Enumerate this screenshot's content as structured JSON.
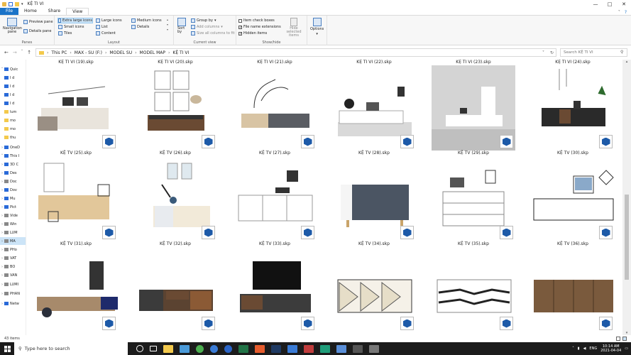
{
  "window": {
    "title": "KỆ TI VI",
    "controls": [
      "—",
      "□",
      "✕"
    ]
  },
  "tabs": [
    {
      "label": "File",
      "style": "file"
    },
    {
      "label": "Home",
      "style": ""
    },
    {
      "label": "Share",
      "style": ""
    },
    {
      "label": "View",
      "style": "view"
    }
  ],
  "ribbon": {
    "panes": {
      "navigation_pane": "Navigation pane",
      "preview_pane": "Preview pane",
      "details_pane": "Details pane",
      "label": "Panes"
    },
    "layout": {
      "items": [
        "Extra large icons",
        "Large icons",
        "Medium icons",
        "Small icons",
        "List",
        "Details",
        "Tiles",
        "Content"
      ],
      "label": "Layout"
    },
    "current_view": {
      "sort_by": "Sort by",
      "group_by": "Group by",
      "add_columns": "Add columns",
      "size_columns": "Size all columns to fit",
      "label": "Current view"
    },
    "show_hide": {
      "item_check_boxes": "Item check boxes",
      "file_name_extensions": "File name extensions",
      "hidden_items": "Hidden items",
      "hide_selected": "Hide selected items",
      "label": "Show/hide"
    },
    "options": "Options"
  },
  "address": {
    "crumbs": [
      "This PC",
      "MAX - SU (F:)",
      "MODEL SU",
      "MODEL MAP",
      "KỆ TI VI"
    ],
    "search_placeholder": "Search KỆ TI VI"
  },
  "navpane": {
    "items": [
      {
        "label": "Quic",
        "caret": "˅",
        "color": "#2a6ad8"
      },
      {
        "label": "I d",
        "caret": "",
        "color": "#2a6ad8"
      },
      {
        "label": "I d",
        "caret": "",
        "color": "#2a6ad8"
      },
      {
        "label": "I d",
        "caret": "",
        "color": "#2a6ad8"
      },
      {
        "label": "I d",
        "caret": "",
        "color": "#2a6ad8"
      },
      {
        "label": "lum",
        "caret": "",
        "color": "#f3c94c"
      },
      {
        "label": "mo",
        "caret": "",
        "color": "#f3c94c"
      },
      {
        "label": "mo",
        "caret": "",
        "color": "#f3c94c"
      },
      {
        "label": "thu",
        "caret": "",
        "color": "#f3c94c"
      },
      {
        "label": "OneD",
        "caret": "›",
        "color": "#2a6ad8"
      },
      {
        "label": "This I",
        "caret": "˅",
        "color": "#2a6ad8"
      },
      {
        "label": "3D C",
        "caret": "›",
        "color": "#2a6ad8"
      },
      {
        "label": "Des",
        "caret": "›",
        "color": "#2a6ad8"
      },
      {
        "label": "Doc",
        "caret": "›",
        "color": "#888"
      },
      {
        "label": "Dov",
        "caret": "›",
        "color": "#2a6ad8"
      },
      {
        "label": "Mu",
        "caret": "›",
        "color": "#2a6ad8"
      },
      {
        "label": "Pict",
        "caret": "›",
        "color": "#2a6ad8"
      },
      {
        "label": "Vide",
        "caret": "›",
        "color": "#888"
      },
      {
        "label": "Win",
        "caret": "›",
        "color": "#888"
      },
      {
        "label": "LUM",
        "caret": "›",
        "color": "#888"
      },
      {
        "label": "MA",
        "caret": "›",
        "color": "#888"
      },
      {
        "label": "PHo",
        "caret": "›",
        "color": "#888"
      },
      {
        "label": "VAT",
        "caret": "›",
        "color": "#888"
      },
      {
        "label": "BO",
        "caret": "›",
        "color": "#888"
      },
      {
        "label": "VAN",
        "caret": "›",
        "color": "#888"
      },
      {
        "label": "LUMI",
        "caret": "›",
        "color": "#888"
      },
      {
        "label": "PHAN",
        "caret": "›",
        "color": "#888"
      },
      {
        "label": "Netw",
        "caret": "›",
        "color": "#2a6ad8"
      }
    ]
  },
  "files": [
    {
      "name": "KỆ TI VI (19).skp"
    },
    {
      "name": "KỆ TI VI (20).skp"
    },
    {
      "name": "KỆ TI VI (21).skp"
    },
    {
      "name": "KỆ TI VI (22).skp"
    },
    {
      "name": "KỆ TI VI (23).skp"
    },
    {
      "name": "KỆ TI VI (24).skp"
    },
    {
      "name": "KỆ TV (25).skp"
    },
    {
      "name": "KỆ TV (26).skp"
    },
    {
      "name": "KỆ TV (27).skp"
    },
    {
      "name": "KỆ TV (28).skp"
    },
    {
      "name": "KỆ TV (29).skp"
    },
    {
      "name": "KỆ TV (30).skp"
    },
    {
      "name": "KỆ TV (31).skp"
    },
    {
      "name": "KỆ TV (32).skp"
    },
    {
      "name": "KỆ TV (33).skp"
    },
    {
      "name": "KỆ TV (34).skp"
    },
    {
      "name": "KỆ TV (35).skp"
    },
    {
      "name": "KỆ TV (36).skp"
    }
  ],
  "status": {
    "count": "43 items"
  },
  "taskbar": {
    "search_placeholder": "Type here to search",
    "tray": {
      "lang": "ENG",
      "time": "10:14 AM",
      "date": "2021-04-04"
    }
  }
}
